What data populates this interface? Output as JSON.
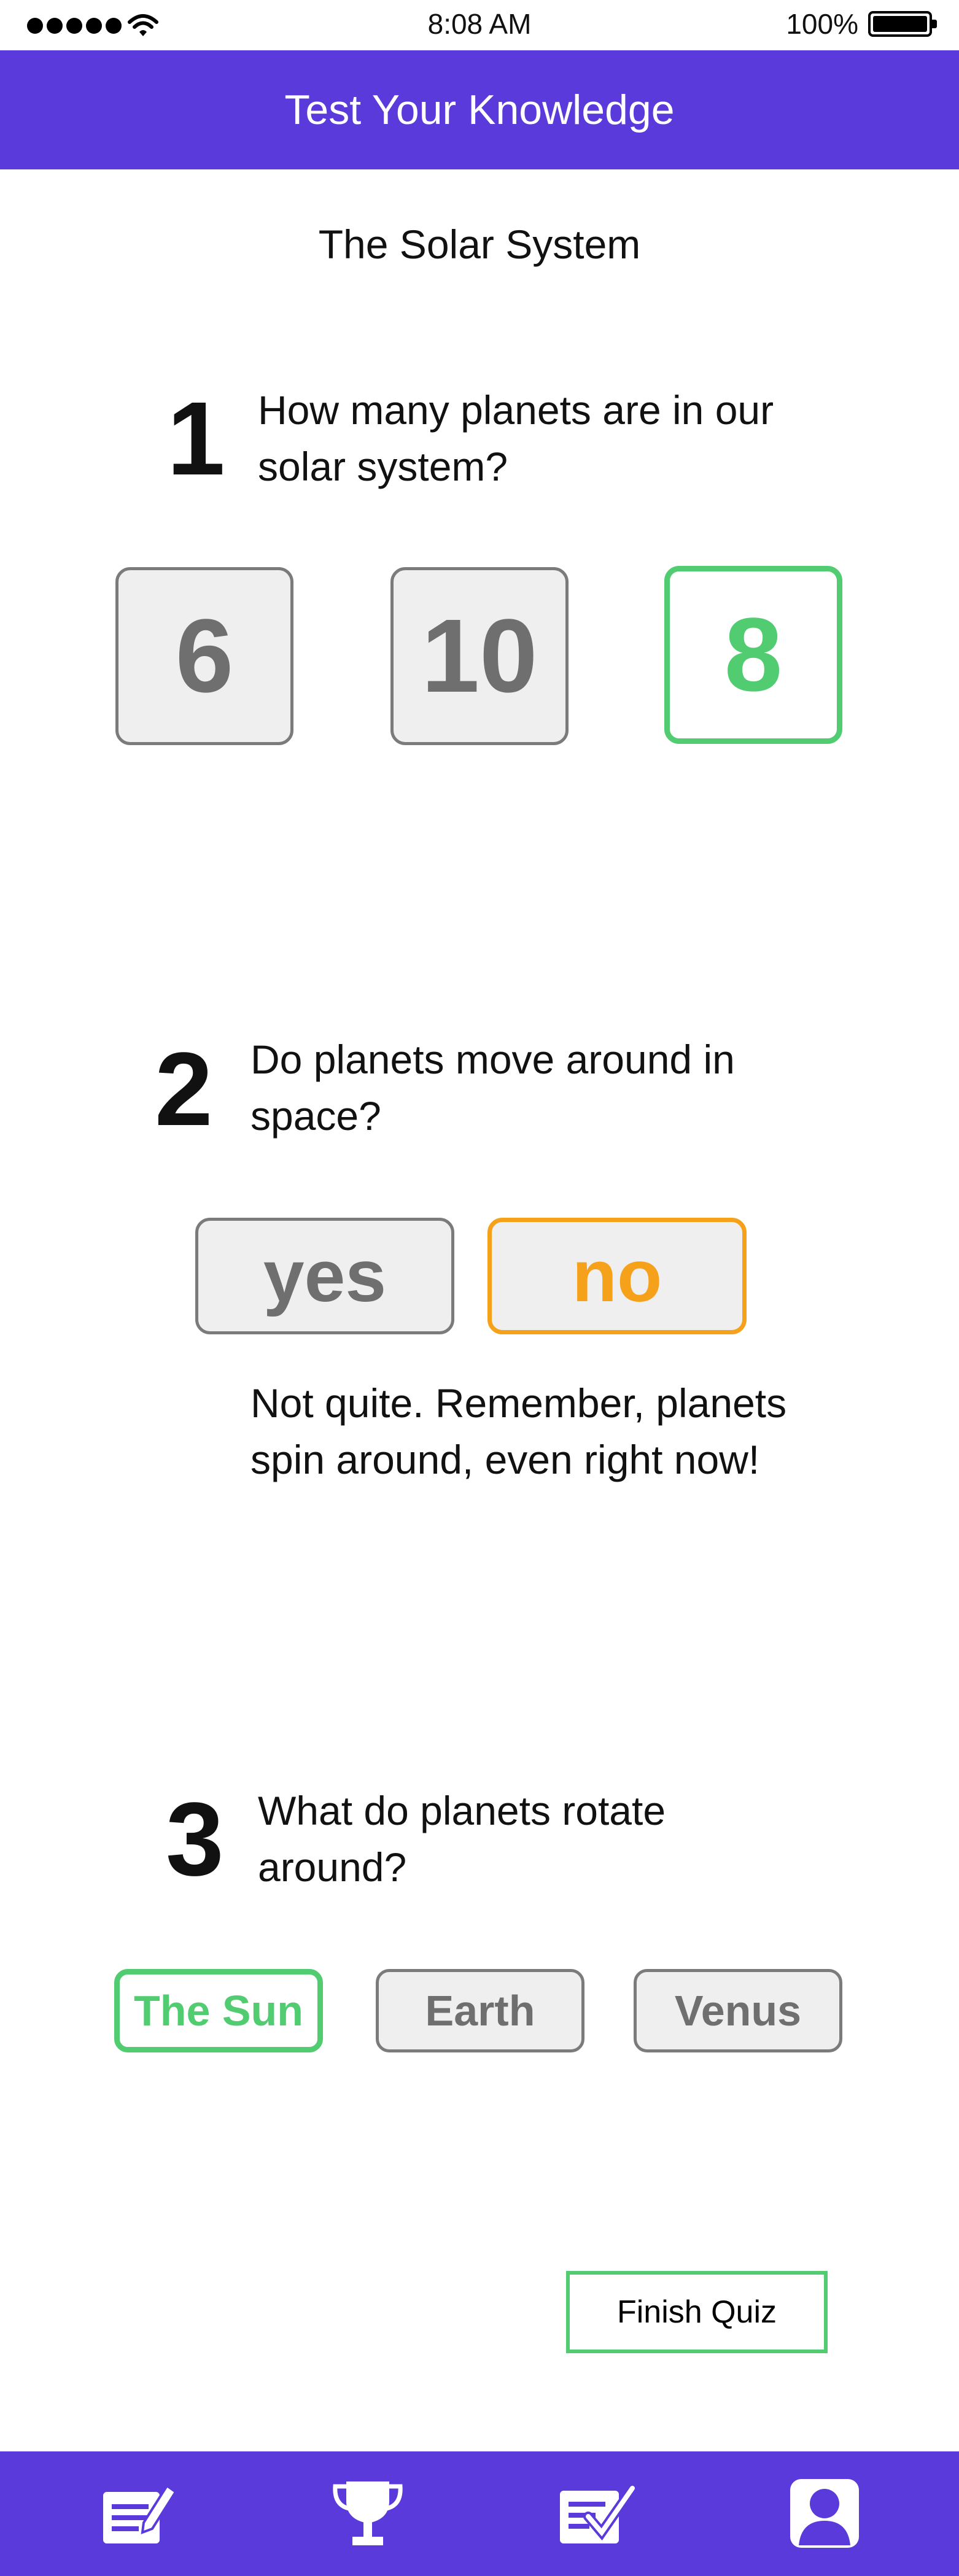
{
  "status": {
    "time": "8:08 AM",
    "battery": "100%"
  },
  "header": {
    "title": "Test Your Knowledge"
  },
  "quiz": {
    "title": "The Solar System",
    "questions": [
      {
        "number": "1",
        "text": "How many planets are in our solar system?",
        "options": [
          "6",
          "10",
          "8"
        ]
      },
      {
        "number": "2",
        "text": "Do planets move around in space?",
        "options": [
          "yes",
          "no"
        ],
        "feedback": "Not quite. Remember, planets spin around, even right now!"
      },
      {
        "number": "3",
        "text": "What do planets rotate around?",
        "options": [
          "The Sun",
          "Earth",
          "Venus"
        ]
      }
    ]
  },
  "finish_label": "Finish Quiz",
  "colors": {
    "primary": "#5b3adb",
    "correct": "#52cc71",
    "wrong": "#f5a11a",
    "neutral_border": "#7b7b7b"
  },
  "tabs": [
    {
      "icon": "edit-note-icon"
    },
    {
      "icon": "trophy-icon"
    },
    {
      "icon": "checklist-icon"
    },
    {
      "icon": "profile-icon"
    }
  ]
}
